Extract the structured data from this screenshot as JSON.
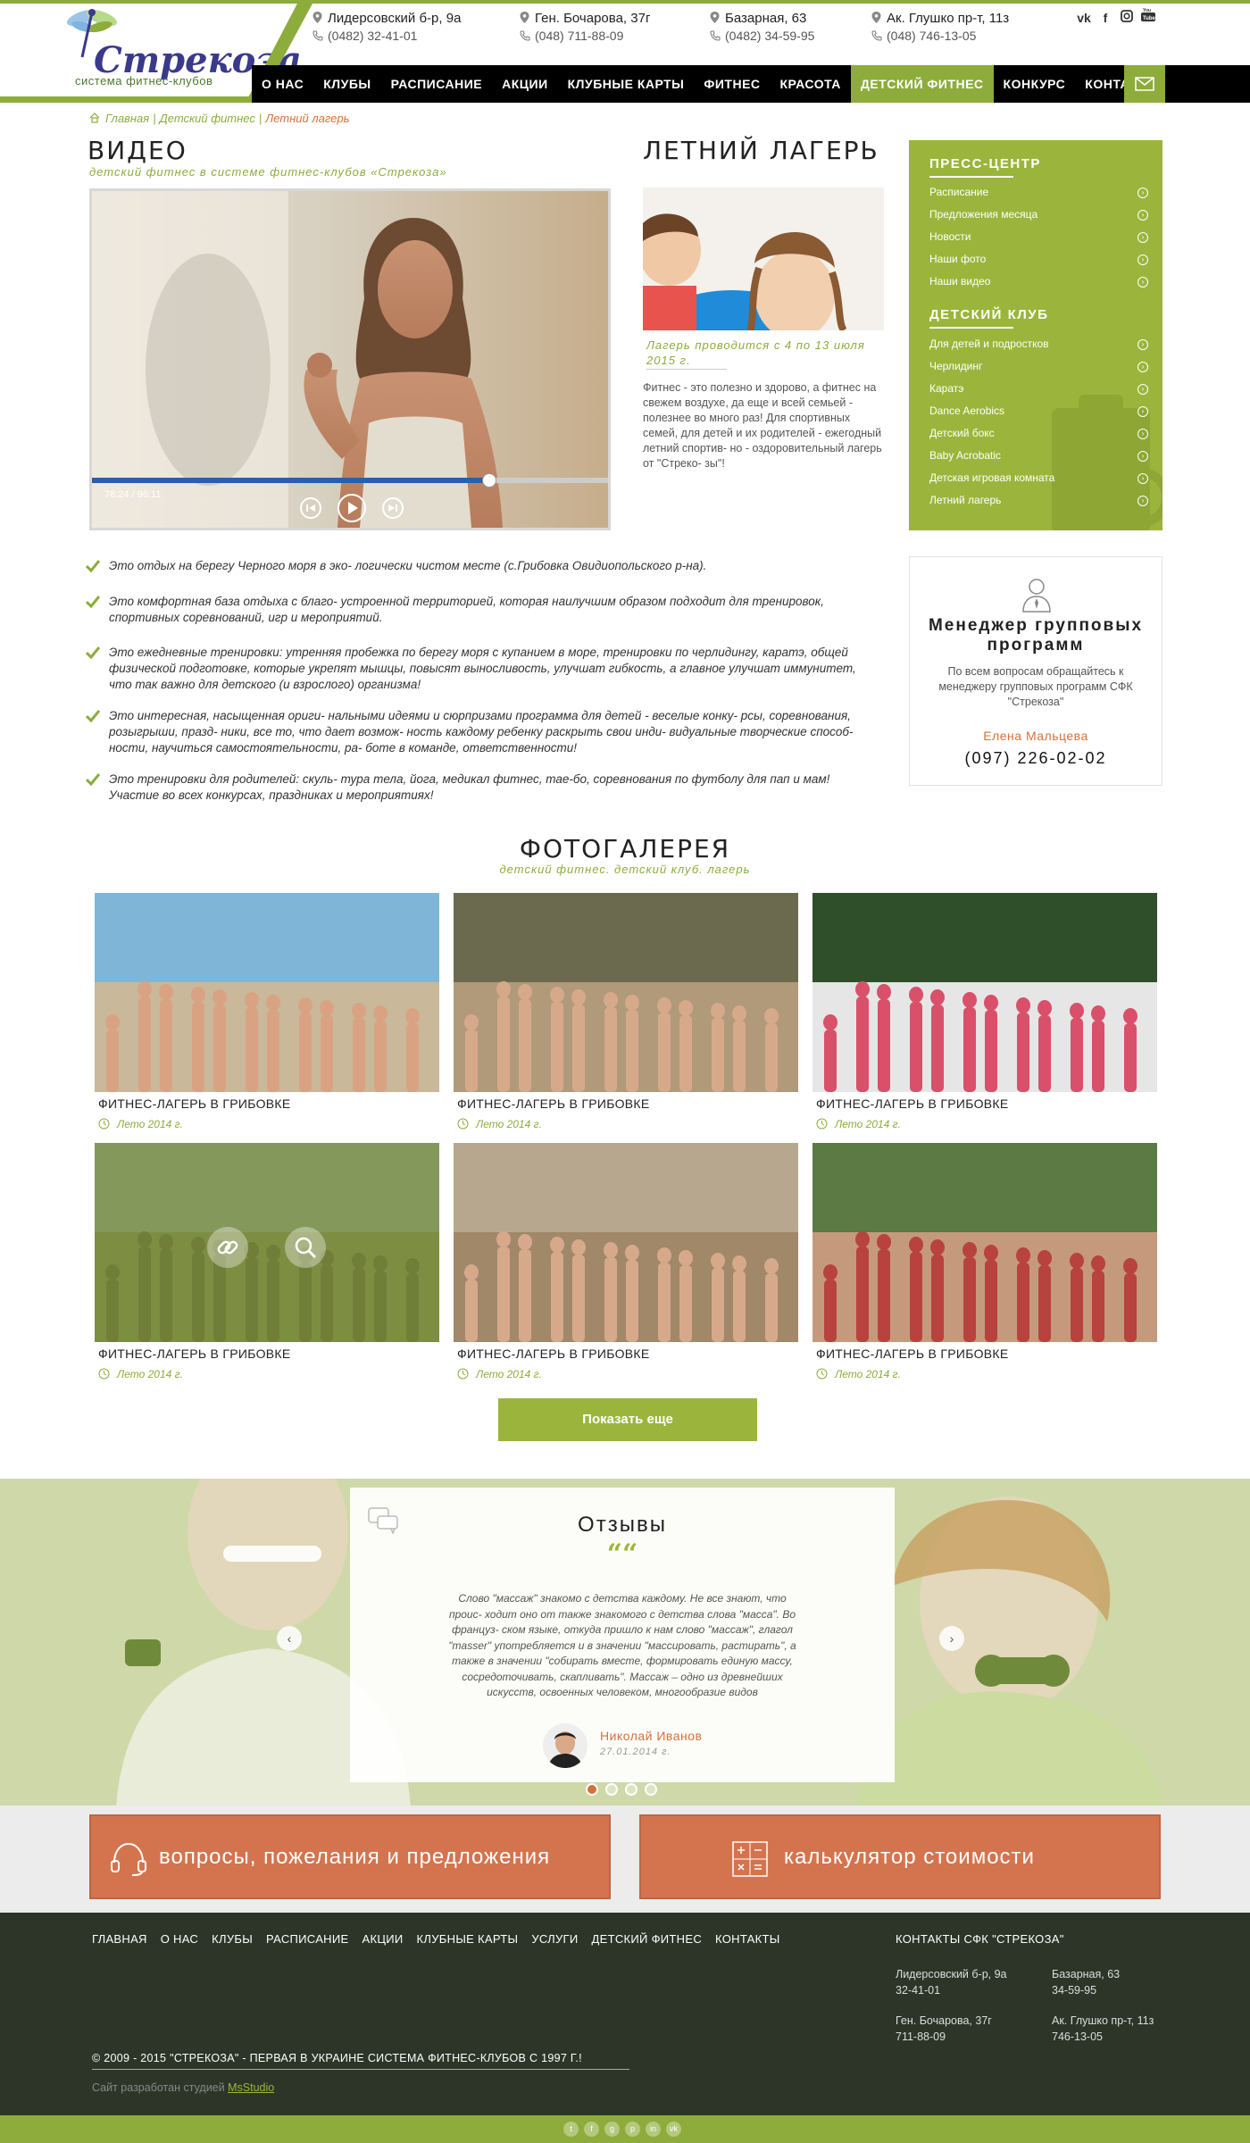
{
  "header": {
    "logo_text": "Стрекоза",
    "logo_sub": "система фитнес-клубов",
    "addresses": [
      {
        "address": "Лидерсовский б-р, 9а",
        "phone": "(0482) 32-41-01"
      },
      {
        "address": "Ген. Бочарова, 37г",
        "phone": "(048) 711-88-09"
      },
      {
        "address": "Базарная, 63",
        "phone": "(0482) 34-59-95"
      },
      {
        "address": "Ак. Глушко пр-т, 11з",
        "phone": "(048) 746-13-05"
      }
    ],
    "socials": [
      "vk-icon",
      "facebook-icon",
      "instagram-icon",
      "youtube-icon"
    ]
  },
  "nav": {
    "items": [
      "О нас",
      "Клубы",
      "Расписание",
      "Акции",
      "Клубные карты",
      "Фитнес",
      "Красота",
      "Детский фитнес",
      "Конкурс",
      "Контакты"
    ],
    "active": "Детский фитнес"
  },
  "breadcrumb": {
    "home": "Главная",
    "parent": "Детский фитнес",
    "current": "Летний лагерь"
  },
  "video": {
    "title": "Видео",
    "subtitle": "детский фитнес в системе фитнес-клубов «Стрекоза»",
    "time": "78:24 / 96:11",
    "progress": 0.77
  },
  "camp": {
    "title": "Летний лагерь",
    "dates": "Лагерь проводится с 4 по 13 июля 2015 г.",
    "text": "Фитнес - это полезно и здорово, а фитнес на свежем воздухе, да еще и всей семьей - полезнее во много раз! Для спортивных семей, для детей и их родителей - ежегодный летний спортив- но - оздоровительный лагерь от \"Стреко- зы\"!"
  },
  "sidebar": {
    "press_title": "Пресс-центр",
    "press_items": [
      "Расписание",
      "Предложения месяца",
      "Новости",
      "Наши фото",
      "Наши видео"
    ],
    "kids_title": "Детский клуб",
    "kids_items": [
      "Для детей и подростков",
      "Черлидинг",
      "Каратэ",
      "Dance Aerobics",
      "Детский бокс",
      "Baby Acrobatic",
      "Детская игровая комната",
      "Летний лагерь"
    ]
  },
  "features": [
    "Это отдых на берегу Черного моря в эко- логически чистом месте (с.Грибовка Овидиопольского р-на).",
    "Это комфортная база отдыха с благо- устроенной территорией, которая наилучшим образом подходит для тренировок, спортивных соревнований, игр и мероприятий.",
    "Это ежедневные тренировки: утренняя пробежка по берегу моря с купанием в море, тренировки по черлидингу, каратэ, общей физической подготовке, которые укрепят мышцы, повысят выносливость, улучшат гибкость, а главное улучшат иммунитет, что так важно для детского (и взрослого) организма!",
    "Это интересная, насыщенная ориги- нальными идеями и сюрпризами программа для детей - веселые конку- рсы, соревнования, розыгрыши, празд- ники, все то, что дает возмож- ность каждому ребенку раскрыть свои инди- видуальные творческие способ- ности, научиться самостоятельности, ра- боте в команде, ответственности!",
    "Это тренировки для родителей: скуль- тура тела, йога, медикал фитнес, тае-бо, соревнования по футболу для пап и мам! Участие во всех конкурсах, праздниках и мероприятиях!"
  ],
  "manager": {
    "title": "Менеджер групповых программ",
    "text": "По всем вопросам обращайтесь к менеджеру групповых программ СФК \"Стрекоза\"",
    "name": "Елена Мальцева",
    "phone": "(097) 226-02-02"
  },
  "gallery": {
    "title": "Фотогалерея",
    "subtitle": "детский фитнес. детский клуб. лагерь",
    "items": [
      {
        "caption": "Фитнес-лагерь в Грибовке",
        "date": "Лето 2014 г."
      },
      {
        "caption": "Фитнес-лагерь в Грибовке",
        "date": "Лето 2014 г."
      },
      {
        "caption": "Фитнес-лагерь в Грибовке",
        "date": "Лето 2014 г."
      },
      {
        "caption": "Фитнес-лагерь в Грибовке",
        "date": "Лето 2014 г."
      },
      {
        "caption": "Фитнес-лагерь в Грибовке",
        "date": "Лето 2014 г."
      },
      {
        "caption": "Фитнес-лагерь в Грибовке",
        "date": "Лето 2014 г."
      }
    ],
    "show_more": "Показать еще"
  },
  "reviews": {
    "title": "Отзывы",
    "quote_mark": "““",
    "text": "Слово \"массаж\" знакомо с детства каждому. Не все знают, что проис- ходит оно от также знакомого с детства слова \"масса\". Во француз- ском языке, откуда пришло к нам слово \"массаж\", глагол \"masser\" употребляется и в значении \"массировать, растирать\", а также в значении \"собирать вместе, формировать единую массу, сосредоточивать, скапливать\". Массаж – одно из древнейших искусств, освоенных человеком, многообразие видов",
    "author": "Николай Иванов",
    "date": "27.01.2014 г.",
    "slide_count": 4,
    "active_slide": 1
  },
  "cta": {
    "questions": "вопросы, пожелания и предложения",
    "calculator": "калькулятор стоимости"
  },
  "footer": {
    "nav": [
      "Главная",
      "О нас",
      "Клубы",
      "Расписание",
      "Акции",
      "Клубные карты",
      "Услуги",
      "Детский фитнес",
      "Контакты"
    ],
    "contacts_title": "Контакты СФК \"Стрекоза\"",
    "contacts": [
      {
        "address": "Лидерсовский б-р, 9а",
        "phone": "32-41-01"
      },
      {
        "address": "Базарная, 63",
        "phone": "34-59-95"
      },
      {
        "address": "Ген. Бочарова, 37г",
        "phone": "711-88-09"
      },
      {
        "address": "Ак. Глушко пр-т, 11з",
        "phone": "746-13-05"
      }
    ],
    "copyright": "© 2009 - 2015 \"Стрекоза\" - первая в Украине система фитнес-клубов с 1997 г.!",
    "dev_prefix": "Сайт разработан студией",
    "dev_link": "MsStudio",
    "socials": [
      "twitter-icon",
      "facebook-icon",
      "google-plus-icon",
      "pinterest-icon",
      "linkedin-icon",
      "vk-icon"
    ]
  },
  "colors": {
    "brand_green": "#9bb53c",
    "accent_orange": "#d4744f",
    "nav_black": "#000000",
    "footer_dark": "#2c3528"
  }
}
